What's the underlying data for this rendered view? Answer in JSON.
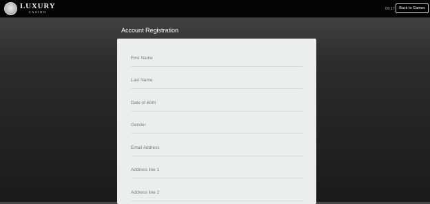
{
  "header": {
    "logo": {
      "main": "LUXURY",
      "sub": "CASINO"
    },
    "clock": "09:17",
    "back_button": "Back to Games"
  },
  "registration": {
    "title": "Account Registration",
    "fields": [
      {
        "label": "First Name"
      },
      {
        "label": "Last Name"
      },
      {
        "label": "Date of Birth"
      },
      {
        "label": "Gender"
      },
      {
        "label": "Email Address"
      },
      {
        "label": "Address line 1"
      },
      {
        "label": "Address line 2"
      }
    ]
  }
}
